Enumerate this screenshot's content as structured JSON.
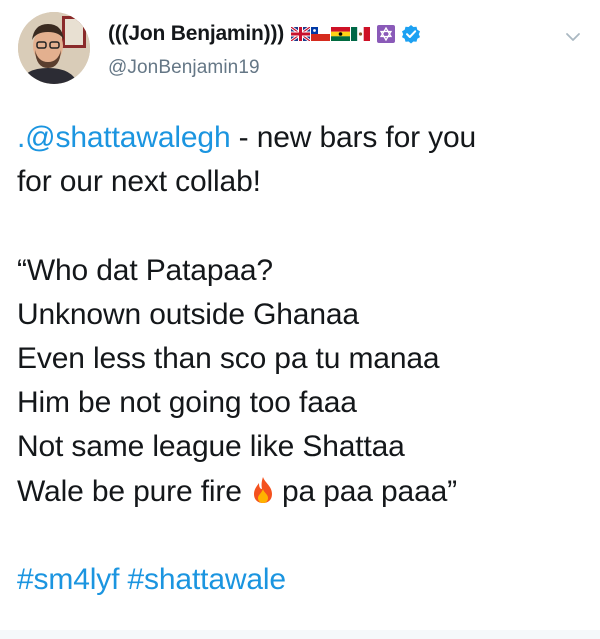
{
  "author": {
    "display_name": "(((Jon Benjamin)))",
    "handle": "@JonBenjamin19",
    "flags": [
      "uk-flag-icon",
      "chile-flag-icon",
      "ghana-flag-icon",
      "mexico-flag-icon",
      "star-of-david-icon"
    ],
    "verified_icon": "verified-badge-icon"
  },
  "menu": {
    "icon": "chevron-down-icon"
  },
  "tweet": {
    "mention": ".@shattawalegh",
    "line1_rest": " - new bars for you",
    "line2": "for our next collab!",
    "verse": [
      "“Who dat Patapaa?",
      "Unknown outside Ghanaa",
      "Even less than sco pa tu manaa",
      "Him be not going too faaa",
      "Not same league like Shattaa"
    ],
    "verse_last_before": "Wale be pure fire ",
    "verse_last_after": "pa paa paaa”",
    "emoji": "fire-icon",
    "hashtags": "#sm4lyf #shattawale"
  },
  "colors": {
    "link": "#1b95e0",
    "text": "#14171a",
    "muted": "#657786",
    "verified": "#1da1f2"
  }
}
